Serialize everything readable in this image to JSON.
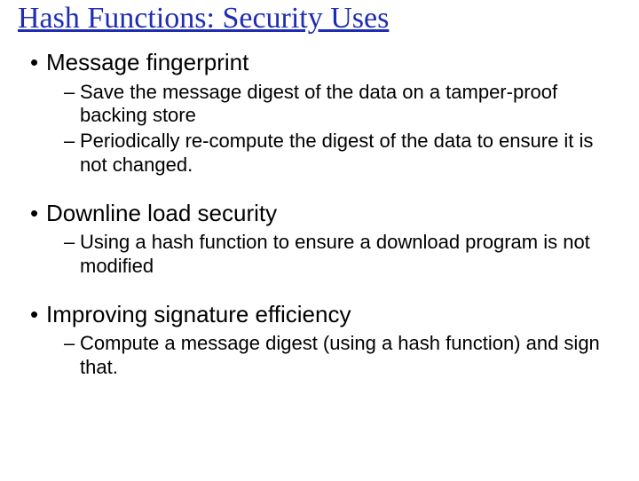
{
  "title": "Hash Functions: Security Uses",
  "bullets": [
    {
      "text": "Message fingerprint",
      "sub": [
        "Save the message digest of the data on a tamper-proof backing store",
        "Periodically re-compute the digest of the data to ensure it is not changed."
      ]
    },
    {
      "text": "Downline load security",
      "sub": [
        "Using a hash function to ensure a download program is not modified"
      ]
    },
    {
      "text": "Improving signature efficiency",
      "sub": [
        "Compute a message digest (using a hash function) and sign that."
      ]
    }
  ]
}
